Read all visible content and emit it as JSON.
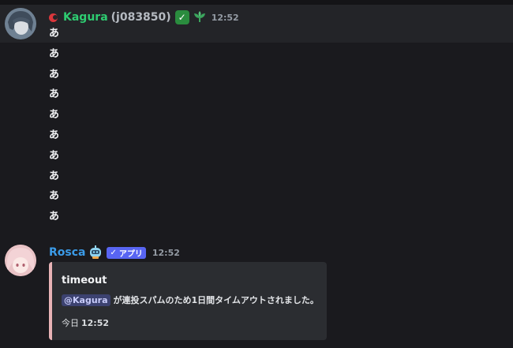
{
  "messages": [
    {
      "author": "Kagura",
      "user_id": "(j083850)",
      "time": "12:52",
      "status": "dnd",
      "colors": {
        "name": "#2ecc71",
        "status": "#da373c"
      },
      "badges": [
        "check-badge-icon",
        "leaf-badge-icon"
      ],
      "lines": [
        "あ",
        "あ",
        "あ",
        "あ",
        "あ",
        "あ",
        "あ",
        "あ",
        "あ",
        "あ"
      ]
    },
    {
      "author": "Rosca",
      "app_tag": "アプリ",
      "time": "12:52",
      "colors": {
        "name": "#3b9be8",
        "app_tag": "#5865f2"
      },
      "badges": [
        "robot-badge-icon"
      ],
      "embed": {
        "accent_color": "#e8b3b6",
        "title": "timeout",
        "mention": "@Kagura",
        "description": "が連投スパムのため1日間タイムアウトされました。",
        "footer_day": "今日",
        "footer_time": "12:52"
      }
    }
  ]
}
